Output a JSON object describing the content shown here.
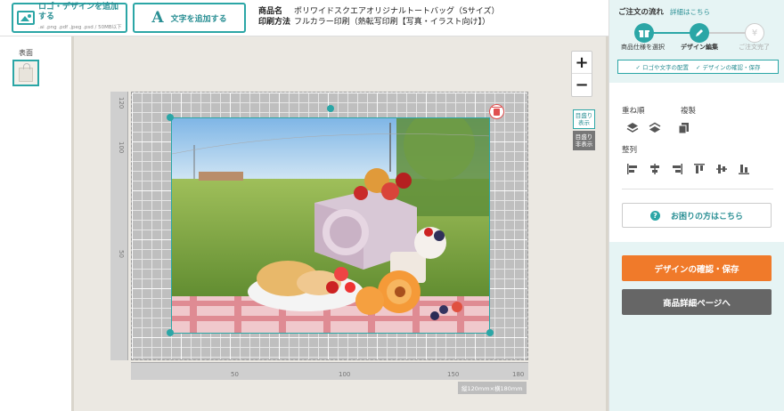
{
  "toolbar": {
    "add_logo_label": "ロゴ・デザインを追加する",
    "add_logo_sub": ".ai .png .pdf .jpeg .psd / 50MB以下",
    "add_text_icon": "A",
    "add_text_label": "文字を追加する"
  },
  "product": {
    "name_key": "商品名",
    "name_value": "ポリワイドスクエアオリジナルトートバッグ（Sサイズ）",
    "method_key": "印刷方法",
    "method_value": "フルカラー印刷（熱転写印刷【写真・イラスト向け】）"
  },
  "thumbs": {
    "label": "表面"
  },
  "canvas": {
    "zoom_in": "+",
    "zoom_out": "−",
    "grid_on": "目盛り\n表示",
    "grid_off": "目盛り\n非表示",
    "ruler_v": [
      "120",
      "100",
      "50"
    ],
    "ruler_h": [
      "50",
      "100",
      "150",
      "180"
    ],
    "size_note": "縦120mm×横180mm"
  },
  "flow": {
    "title": "ご注文の流れ",
    "link": "詳細はこちら",
    "steps": [
      {
        "label": "商品仕様を選択",
        "icon": "gift-icon"
      },
      {
        "label": "デザイン編集",
        "icon": "pencil-icon"
      },
      {
        "label": "ご注文完了",
        "icon": "yen-icon"
      }
    ],
    "substeps": [
      "✓ ロゴや文字の配置",
      "✓ デザインの確認・保存"
    ]
  },
  "panel": {
    "layer_label": "重ね順",
    "copy_label": "複製",
    "align_label": "整列",
    "help_button": "お困りの方はこちら",
    "confirm_button": "デザインの確認・保存",
    "detail_button": "商品詳細ページへ"
  },
  "colors": {
    "accent": "#2ba6a6",
    "orange": "#f07a2a",
    "gray_button": "#666666"
  }
}
